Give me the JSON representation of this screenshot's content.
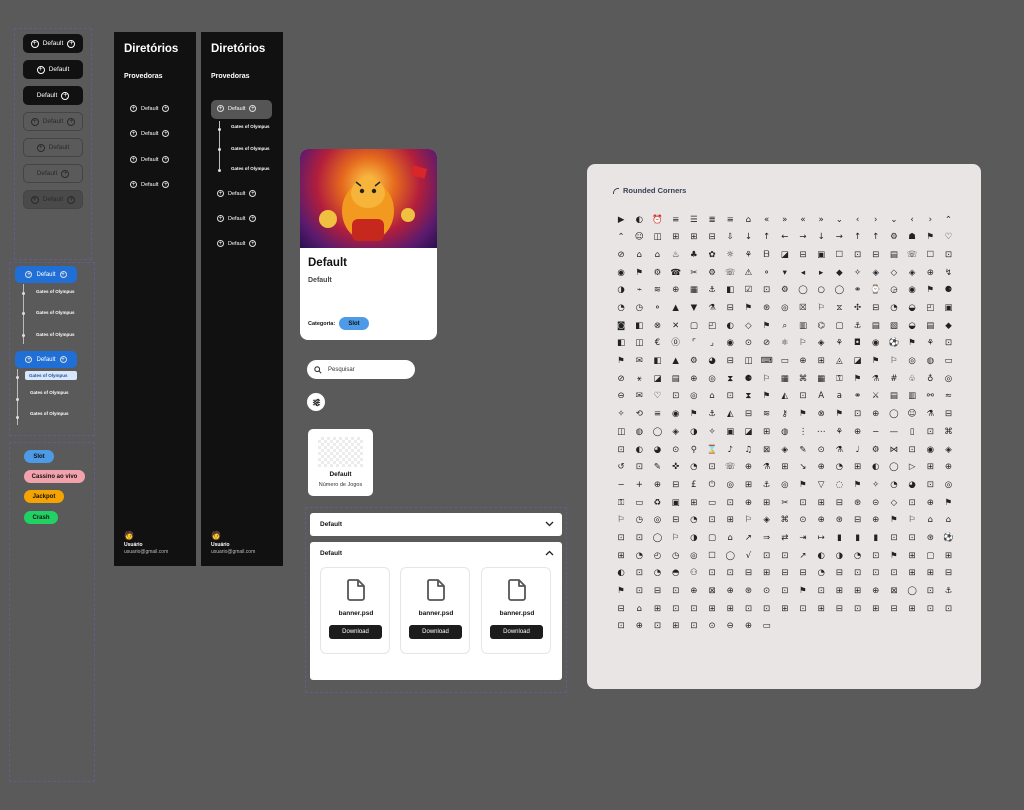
{
  "buttons": {
    "default_label": "Default"
  },
  "sidebar": {
    "title": "Diretórios",
    "section": "Provedoras",
    "items": [
      "Default",
      "Default",
      "Default",
      "Default"
    ],
    "sub_items": [
      "Gates of Olympus",
      "Gates of Olympus",
      "Gates of Olympus"
    ],
    "user_name": "Usuário",
    "user_email": "usuario@gmail.com"
  },
  "tree": {
    "label": "Default",
    "items": [
      "Gates of Olympus",
      "Gates of Olympus",
      "Gates of Olympus"
    ],
    "selected": "Gates of Olympus"
  },
  "tags": [
    {
      "label": "Slot",
      "color": "#4d9be6"
    },
    {
      "label": "Cassino ao vivo",
      "color": "#f2a2ac"
    },
    {
      "label": "Jackpot",
      "color": "#f5a300"
    },
    {
      "label": "Crash",
      "color": "#22d163"
    }
  ],
  "card": {
    "title": "Default",
    "subtitle": "Default",
    "category_label": "Categoria:",
    "category_value": "Slot"
  },
  "search": {
    "placeholder": "Pesquisar"
  },
  "game_card": {
    "title": "Default",
    "caption": "Número de Jogos"
  },
  "accordion": {
    "collapsed_label": "Default",
    "expanded_label": "Default"
  },
  "files": [
    {
      "name": "banner.psd",
      "action": "Download"
    },
    {
      "name": "banner.psd",
      "action": "Download"
    },
    {
      "name": "banner.psd",
      "action": "Download"
    }
  ],
  "icons_panel": {
    "title": "Rounded Corners"
  },
  "colors": {
    "accent": "#1f6fd6",
    "dark": "#111111",
    "panel": "#e8e5e4",
    "background": "#5a5a5a"
  }
}
